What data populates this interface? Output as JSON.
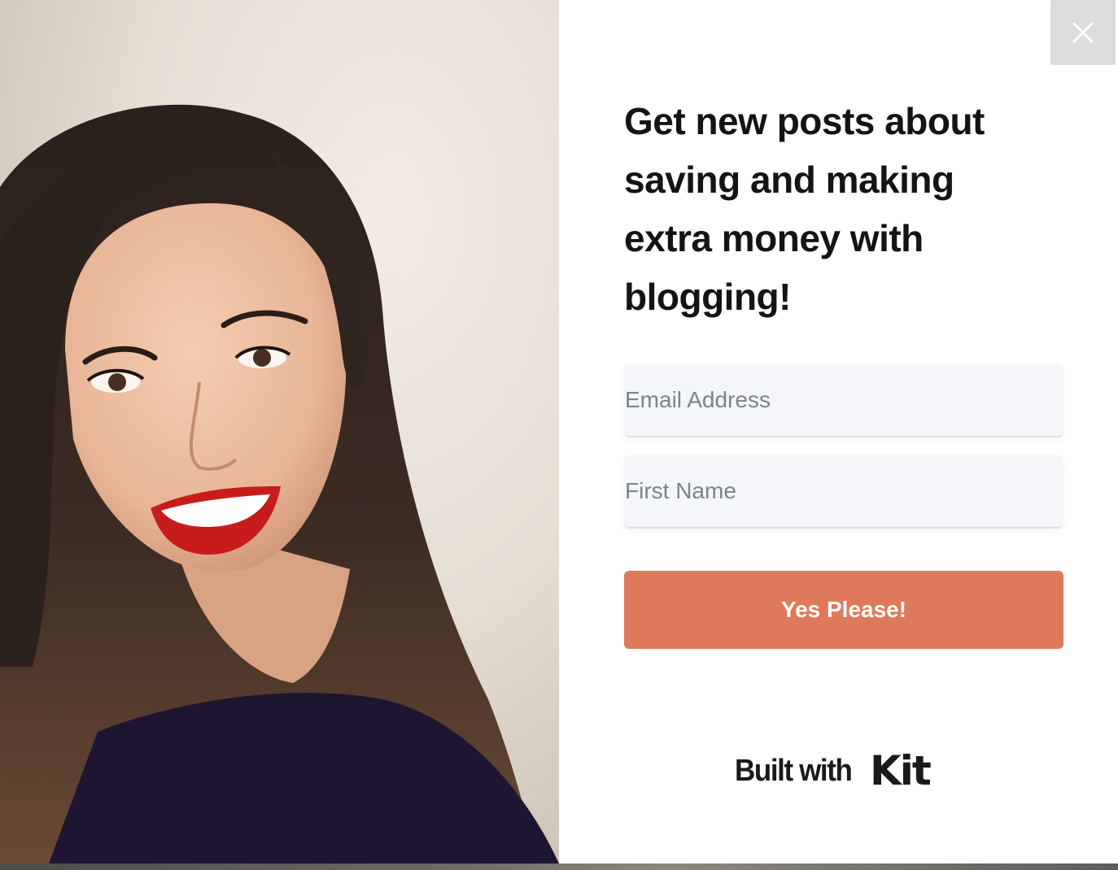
{
  "close_button": {
    "icon": "close-icon",
    "color": "#ffffff",
    "background": "#dcdcdc"
  },
  "photo": {
    "alt": "Smiling woman with long dark hair and red lipstick"
  },
  "form": {
    "headline": "Get new posts about saving and making extra money with blogging!",
    "email_placeholder": "Email Address",
    "first_name_placeholder": "First Name",
    "submit_label": "Yes Please!",
    "submit_color": "#df795b"
  },
  "footer": {
    "built_with": "Built with",
    "brand": "Kit"
  }
}
